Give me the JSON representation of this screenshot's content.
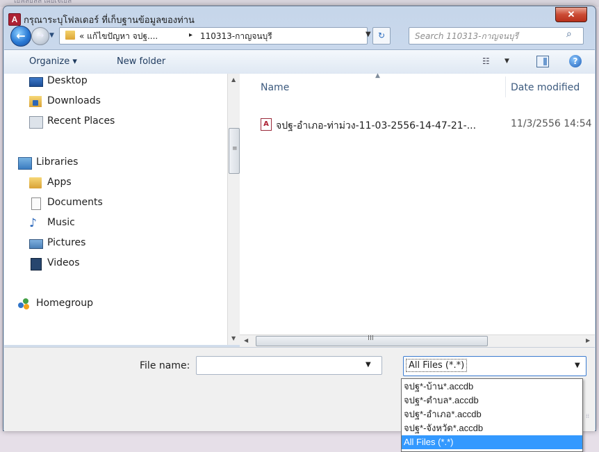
{
  "background": {
    "partial_text": "เยพลยลล เผยเจเยล"
  },
  "window": {
    "title": "กรุณาระบุโฟลเดอร์ ที่เก็บฐานข้อมูลของท่าน",
    "app_icon_letter": "A",
    "close_glyph": "✕"
  },
  "nav": {
    "back_glyph": "←",
    "forward_glyph": "→",
    "breadcrumb": [
      "« แก้ไขปัญหา จปฐ....",
      "110313-กาญจนบุรี"
    ],
    "breadcrumb_separator": "▸",
    "search_placeholder": "Search 110313-กาญจนบุรี"
  },
  "toolbar": {
    "organize_label": "Organize ▾",
    "new_folder_label": "New folder"
  },
  "sidebar": {
    "items": [
      {
        "label": "Desktop",
        "icon": "desktop-icon"
      },
      {
        "label": "Downloads",
        "icon": "downloads-folder-icon"
      },
      {
        "label": "Recent Places",
        "icon": "recent-places-icon"
      },
      {
        "label": "Libraries",
        "icon": "libraries-icon"
      },
      {
        "label": "Apps",
        "icon": "folder-icon"
      },
      {
        "label": "Documents",
        "icon": "documents-icon"
      },
      {
        "label": "Music",
        "icon": "music-icon"
      },
      {
        "label": "Pictures",
        "icon": "pictures-icon"
      },
      {
        "label": "Videos",
        "icon": "videos-icon"
      },
      {
        "label": "Homegroup",
        "icon": "homegroup-icon"
      }
    ]
  },
  "file_list": {
    "columns": {
      "name": "Name",
      "date_modified": "Date modified"
    },
    "files": [
      {
        "name": "จปฐ-อำเภอ-ท่าม่วง-11-03-2556-14-47-21-...",
        "date_modified": "11/3/2556 14:54",
        "icon": "access-database-file-icon"
      }
    ],
    "h_scroll_grip": "III"
  },
  "footer": {
    "file_name_label": "File name:",
    "file_name_value": "",
    "file_type_selected": "All Files (*.*)",
    "file_type_options": [
      "จปฐ*-บ้าน*.accdb",
      "จปฐ*-ตำบล*.accdb",
      "จปฐ*-อำเภอ*.accdb",
      "จปฐ*-จังหวัด*.accdb",
      "All Files (*.*)"
    ],
    "highlighted_option_index": 4
  },
  "colors": {
    "selection_blue": "#3399ff",
    "access_red": "#ad2134",
    "window_frame": "#c6d6ea",
    "close_red": "#c7432d"
  }
}
